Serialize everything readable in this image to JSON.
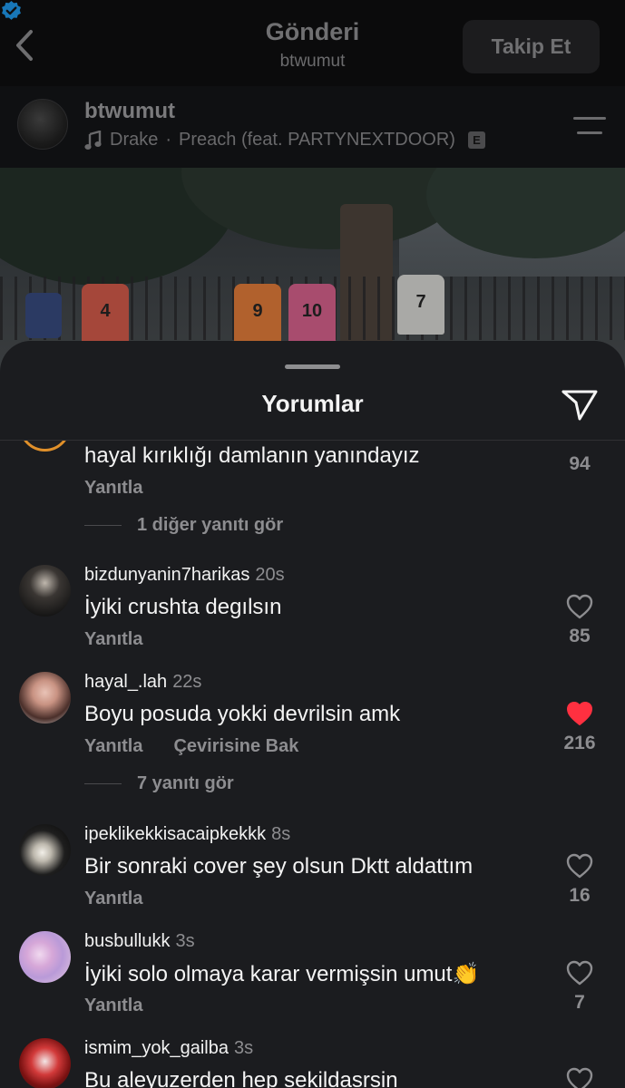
{
  "header": {
    "title": "Gönderi",
    "subtitle": "btwumut",
    "follow_label": "Takip Et"
  },
  "post": {
    "username": "btwumut",
    "verified": true,
    "music_artist": "Drake",
    "music_separator": "·",
    "music_track": "Preach (feat. PARTYNEXTDOOR)",
    "explicit_badge": "E",
    "photo_jerseys": [
      "4",
      "9",
      "10",
      "7"
    ]
  },
  "comments_sheet": {
    "title": "Yorumlar",
    "reply_label": "Yanıtla",
    "translate_label": "Çevirisine Bak",
    "accent_like_color": "#ff3040",
    "comments": [
      {
        "username": "",
        "time": "",
        "text": "hayal kırıklığı damlanın yanındayız",
        "likes": "94",
        "liked": false,
        "more_replies": "1 diğer yanıtı gör"
      },
      {
        "username": "bizdunyanin7harikas",
        "time": "20s",
        "text": "İyiki crushta degılsın",
        "likes": "85",
        "liked": false
      },
      {
        "username": "hayal_.lah",
        "time": "22s",
        "text": "Boyu posuda yokki devrilsin amk",
        "likes": "216",
        "liked": true,
        "more_replies": "7 yanıtı gör"
      },
      {
        "username": "ipeklikekkisacaipkekkk",
        "time": "8s",
        "text": "Bir sonraki cover şey olsun Dktt aldattım",
        "likes": "16",
        "liked": false
      },
      {
        "username": "busbullukk",
        "time": "3s",
        "text": "İyiki solo olmaya karar vermişsin umut👏",
        "likes": "7",
        "liked": false
      },
      {
        "username": "ismim_yok_gailba",
        "time": "3s",
        "text": "Bu aleyuzerden hep sekildasrsin",
        "liked": false
      }
    ]
  }
}
